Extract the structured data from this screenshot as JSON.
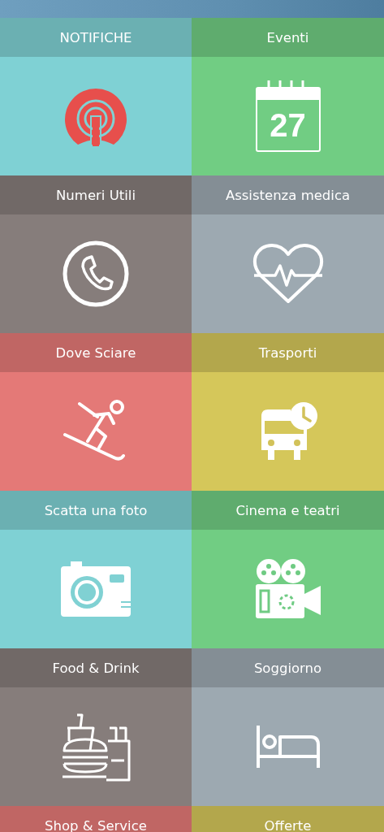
{
  "tiles": [
    {
      "label": "NOTIFICHE",
      "color": "#6bb0b2",
      "kind": "broadcast"
    },
    {
      "label": "Eventi",
      "color": "#5fac6e",
      "kind": "calendar",
      "day": "27"
    },
    {
      "label": "Numeri Utili",
      "color": "#716967",
      "kind": "phone"
    },
    {
      "label": "Assistenza medica",
      "color": "#848e95",
      "kind": "heart"
    },
    {
      "label": "Dove Sciare",
      "color": "#c06664",
      "kind": "ski"
    },
    {
      "label": "Trasporti",
      "color": "#b3a74c",
      "kind": "bus"
    },
    {
      "label": "Scatta una foto",
      "color": "#6bb0b2",
      "kind": "camera"
    },
    {
      "label": "Cinema e teatri",
      "color": "#5fac6e",
      "kind": "projector"
    },
    {
      "label": "Food & Drink",
      "color": "#716967",
      "kind": "food"
    },
    {
      "label": "Soggiorno",
      "color": "#848e95",
      "kind": "bed"
    },
    {
      "label": "Shop & Service",
      "color": "#c06664"
    },
    {
      "label": "Offerte",
      "color": "#b3a74c"
    }
  ]
}
